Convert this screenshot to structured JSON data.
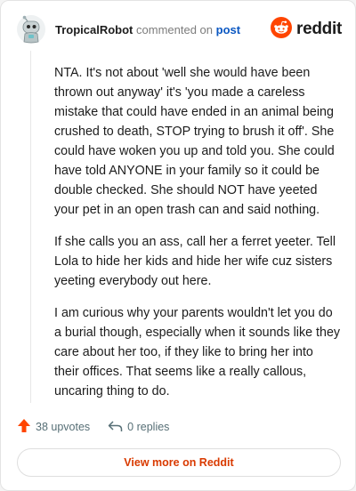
{
  "header": {
    "username": "TropicalRobot",
    "action_text": "commented on",
    "post_link": "post",
    "brand": "reddit"
  },
  "comment": {
    "paragraphs": [
      "NTA. It's not about 'well she would have been thrown out anyway' it's 'you made a careless mistake that could have ended in an animal being crushed to death, STOP trying to brush it off'. She could have woken you up and told you. She could have told ANYONE in your family so it could be double checked. She should NOT have yeeted your pet in an open trash can and said nothing.",
      "If she calls you an ass, call her a ferret yeeter. Tell Lola to hide her kids and hide her wife cuz sisters yeeting everybody out here.",
      "I am curious why your parents wouldn't let you do a burial though, especially when it sounds like they care about her too, if they like to bring her into their offices. That seems like a really callous, uncaring thing to do."
    ]
  },
  "actions": {
    "upvotes": "38 upvotes",
    "replies": "0 replies"
  },
  "footer": {
    "view_more": "View more on Reddit"
  },
  "colors": {
    "brand_orange": "#ff4500",
    "upvote_orange": "#ff4500",
    "link_blue": "#0a57c2",
    "view_more_text": "#d93a00"
  },
  "icons": {
    "avatar": "snoo-avatar-icon",
    "brand": "reddit-logo-icon",
    "upvote": "upvote-arrow-icon",
    "reply": "reply-arrow-icon"
  }
}
